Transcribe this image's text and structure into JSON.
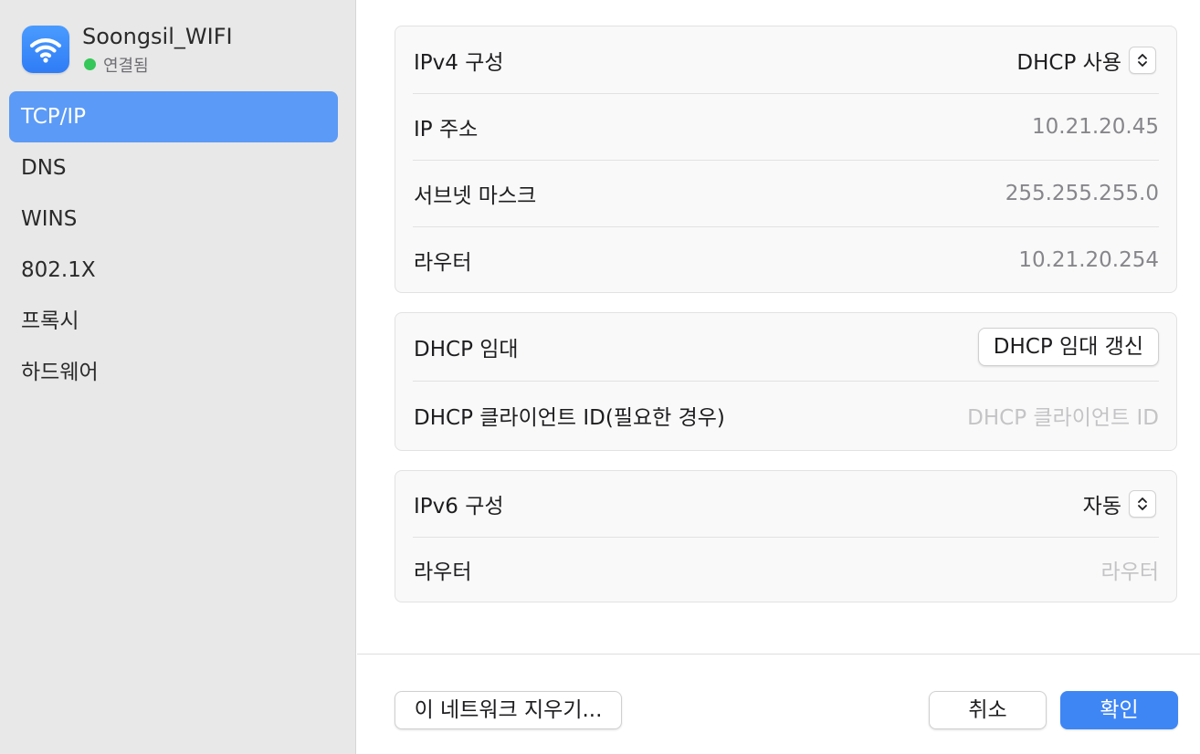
{
  "sidebar": {
    "network_name": "Soongsil_WIFI",
    "status": "연결됨",
    "status_color": "#35c759",
    "icon": "wifi-icon",
    "items": [
      {
        "label": "TCP/IP",
        "selected": true
      },
      {
        "label": "DNS",
        "selected": false
      },
      {
        "label": "WINS",
        "selected": false
      },
      {
        "label": "802.1X",
        "selected": false
      },
      {
        "label": "프록시",
        "selected": false
      },
      {
        "label": "하드웨어",
        "selected": false
      }
    ]
  },
  "ipv4": {
    "config_label": "IPv4 구성",
    "config_value": "DHCP 사용",
    "ip_label": "IP 주소",
    "ip_value": "10.21.20.45",
    "subnet_label": "서브넷 마스크",
    "subnet_value": "255.255.255.0",
    "router_label": "라우터",
    "router_value": "10.21.20.254"
  },
  "dhcp": {
    "lease_label": "DHCP 임대",
    "renew_button": "DHCP 임대 갱신",
    "client_id_label": "DHCP 클라이언트 ID(필요한 경우)",
    "client_id_placeholder": "DHCP 클라이언트 ID"
  },
  "ipv6": {
    "config_label": "IPv6 구성",
    "config_value": "자동",
    "router_label": "라우터",
    "router_placeholder": "라우터"
  },
  "footer": {
    "forget_button": "이 네트워크 지우기...",
    "cancel_button": "취소",
    "ok_button": "확인",
    "accent_color": "#3f86f5"
  }
}
